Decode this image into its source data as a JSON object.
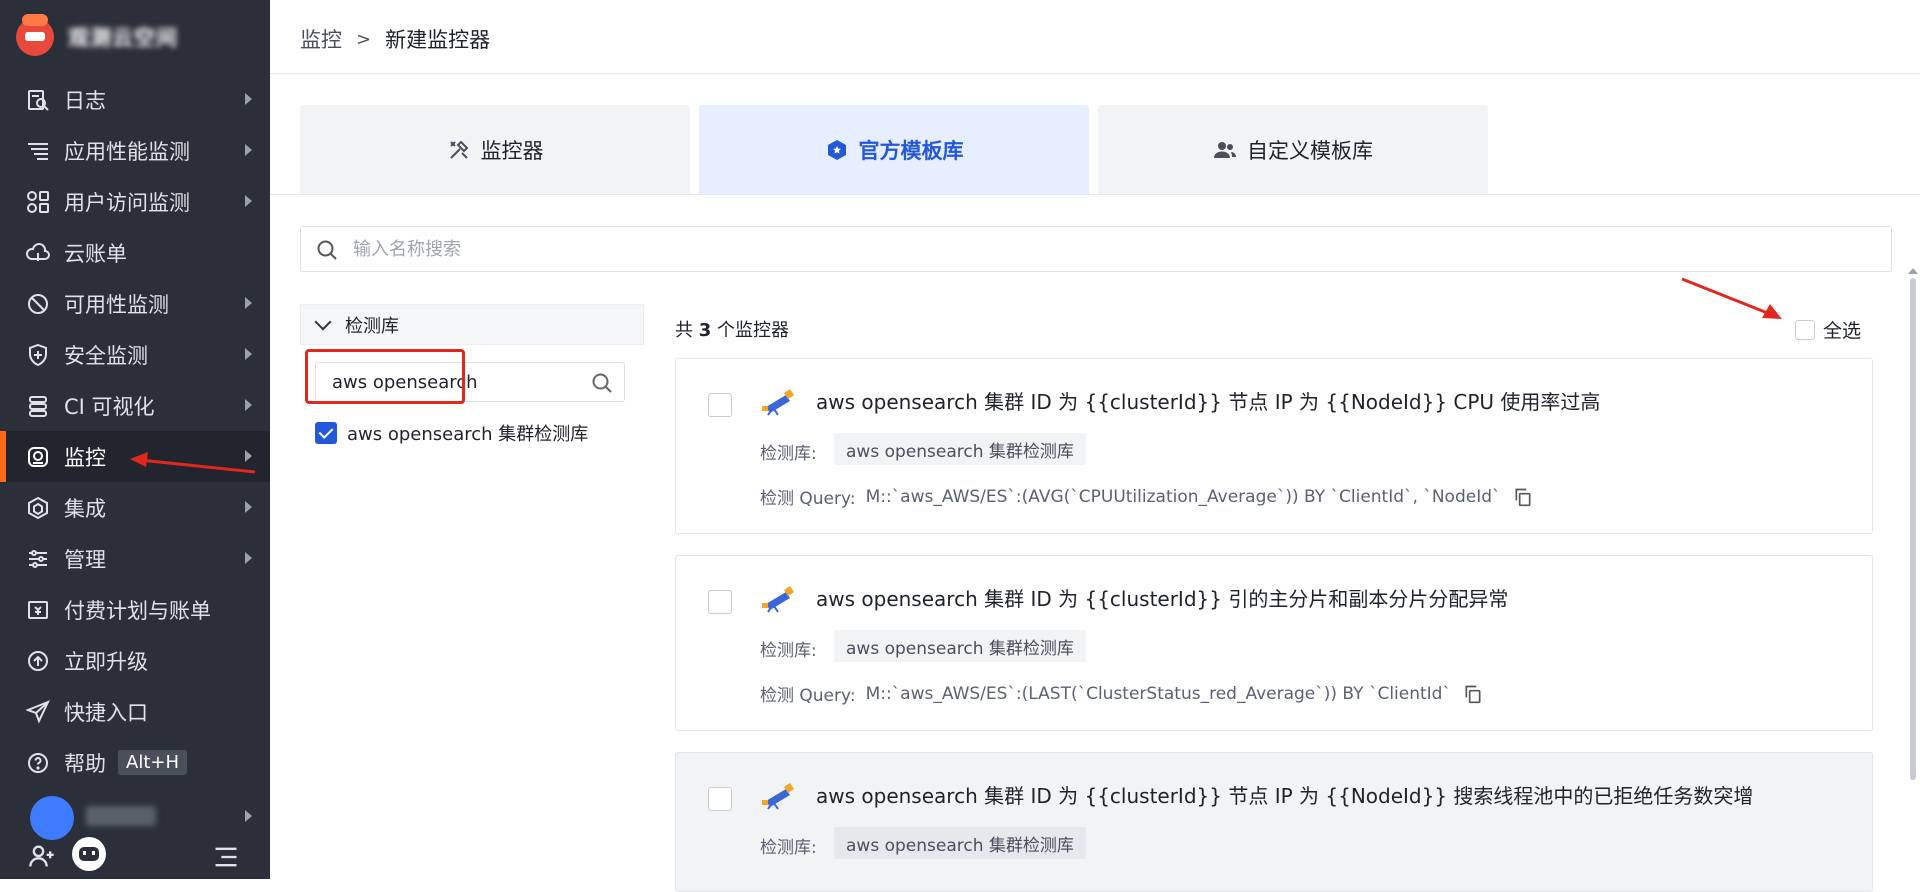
{
  "sidebar": {
    "org_name": "观测云空间",
    "items": [
      {
        "label": "日志",
        "icon": "log-search-icon",
        "has_arrow": true
      },
      {
        "label": "应用性能监测",
        "icon": "apm-list-icon",
        "has_arrow": true
      },
      {
        "label": "用户访问监测",
        "icon": "rum-grid-icon",
        "has_arrow": true
      },
      {
        "label": "云账单",
        "icon": "cloud-bill-icon",
        "has_arrow": false
      },
      {
        "label": "可用性监测",
        "icon": "availability-icon",
        "has_arrow": true
      },
      {
        "label": "安全监测",
        "icon": "shield-icon",
        "has_arrow": true
      },
      {
        "label": "CI 可视化",
        "icon": "ci-icon",
        "has_arrow": true
      },
      {
        "label": "监控",
        "icon": "monitor-icon",
        "has_arrow": true,
        "active": true
      },
      {
        "label": "集成",
        "icon": "integration-icon",
        "has_arrow": true
      },
      {
        "label": "管理",
        "icon": "settings-sliders-icon",
        "has_arrow": true
      },
      {
        "label": "付费计划与账单",
        "icon": "billing-icon",
        "has_arrow": false
      },
      {
        "label": "立即升级",
        "icon": "upgrade-icon",
        "has_arrow": false
      },
      {
        "label": "快捷入口",
        "icon": "shortcut-send-icon",
        "has_arrow": false
      },
      {
        "label": "帮助",
        "icon": "help-icon",
        "has_arrow": false,
        "shortcut": "Alt+H"
      }
    ]
  },
  "breadcrumb": {
    "first": "监控",
    "separator": ">",
    "current": "新建监控器"
  },
  "tabs": [
    {
      "label": "监控器",
      "icon": "tools-icon"
    },
    {
      "label": "官方模板库",
      "icon": "hexagon-badge-icon",
      "active": true
    },
    {
      "label": "自定义模板库",
      "icon": "users-icon"
    }
  ],
  "search": {
    "placeholder": "输入名称搜索",
    "value": ""
  },
  "filter": {
    "header": "检测库",
    "input_value": "aws opensearch",
    "options": [
      {
        "label": "aws opensearch 集群检测库",
        "checked": true
      }
    ]
  },
  "list": {
    "count_prefix": "共",
    "count": "3",
    "count_suffix": "个监控器",
    "select_all": "全选",
    "lib_label": "检测库:",
    "query_label": "检测 Query:",
    "items": [
      {
        "title": "aws opensearch 集群 ID 为 {{clusterId}} 节点 IP 为 {{NodeId}} CPU 使用率过高",
        "lib": "aws opensearch 集群检测库",
        "query": "M::`aws_AWS/ES`:(AVG(`CPUUtilization_Average`)) BY `ClientId`, `NodeId`"
      },
      {
        "title": "aws opensearch 集群 ID 为 {{clusterId}} 引的主分片和副本分片分配异常",
        "lib": "aws opensearch 集群检测库",
        "query": "M::`aws_AWS/ES`:(LAST(`ClusterStatus_red_Average`)) BY `ClientId`"
      },
      {
        "title": "aws opensearch 集群 ID 为 {{clusterId}} 节点 IP 为 {{NodeId}} 搜索线程池中的已拒绝任务数突增",
        "lib": "aws opensearch 集群检测库",
        "query": ""
      }
    ]
  },
  "colors": {
    "accent": "#2458d8",
    "sidebar_bg": "#2b2f3a",
    "active_marker": "#ff6a1a",
    "annotation_red": "#e0281f"
  }
}
